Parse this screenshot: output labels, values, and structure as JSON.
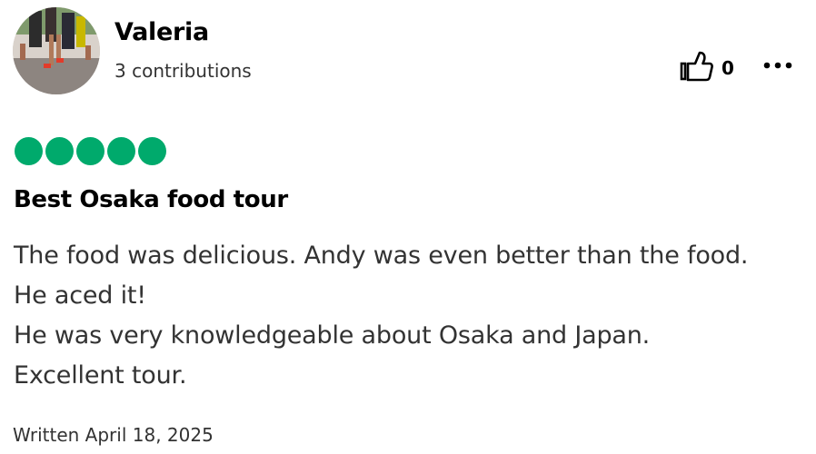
{
  "user": {
    "name": "Valeria",
    "contributions": "3 contributions"
  },
  "actions": {
    "helpful_count": "0",
    "helpful_icon": "thumbs-up-icon",
    "more_icon": "more-options-icon"
  },
  "review": {
    "rating": 5,
    "rating_max": 5,
    "rating_color": "#00aa6c",
    "title": "Best Osaka food tour",
    "lines": [
      "The food was delicious. Andy was even better than the food.",
      "He aced it!",
      "He was very knowledgeable about Osaka and Japan.",
      "Excellent tour."
    ],
    "written": "Written April 18, 2025"
  }
}
